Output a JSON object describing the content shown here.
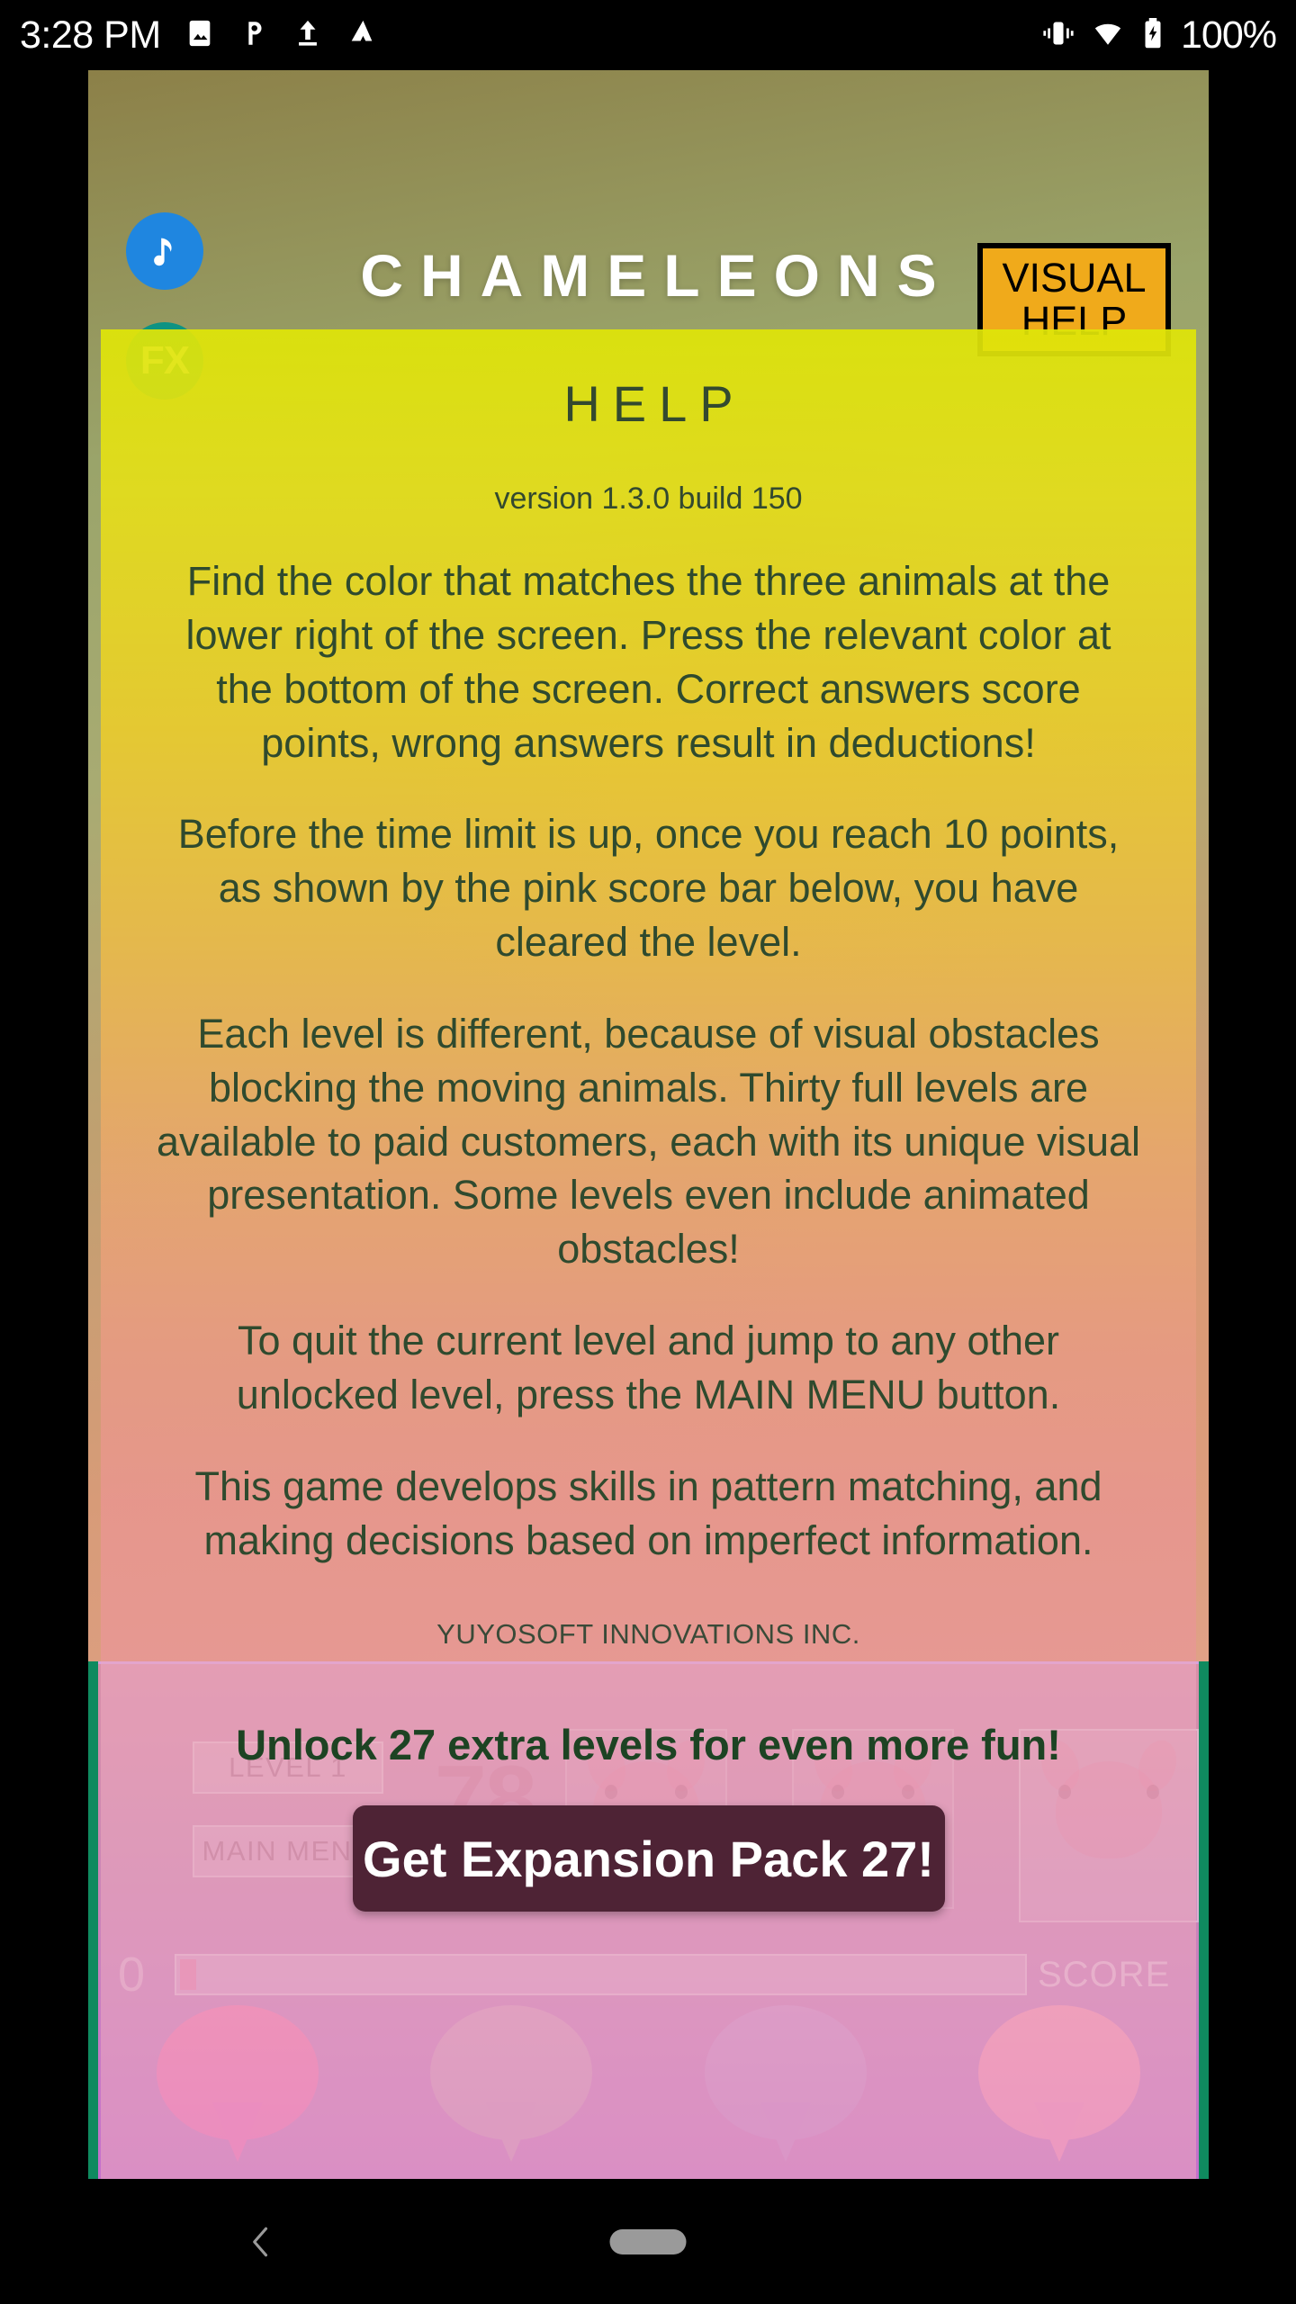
{
  "status_bar": {
    "time": "3:28 PM",
    "battery": "100%",
    "icons": [
      "image-icon",
      "photos-icon",
      "upload-icon",
      "drive-icon",
      "vibrate-icon",
      "wifi-icon",
      "battery-charging-icon"
    ]
  },
  "header": {
    "app_title": "CHAMELEONS",
    "visual_help_line1": "VISUAL",
    "visual_help_line2": "HELP",
    "music_icon": "music-note-icon",
    "fx_label": "FX"
  },
  "help_panel": {
    "title": "HELP",
    "version": "version 1.3.0 build 150",
    "paragraphs": [
      "Find the color that matches the three animals at the lower right of the screen. Press the relevant color at the bottom of the screen. Correct answers score points, wrong answers result in deductions!",
      "Before the time limit is up, once you reach 10 points, as shown by the pink score bar below, you have cleared the level.",
      "Each level is different, because of visual obstacles blocking the moving animals. Thirty full levels are available to paid customers, each with its unique visual presentation. Some levels even include animated obstacles!",
      "To quit the current level and jump to any other unlocked level, press the MAIN MENU button.",
      "This game develops skills in pattern matching, and making decisions based on imperfect information."
    ],
    "company": "YUYOSOFT INNOVATIONS INC."
  },
  "promo": {
    "headline": "Unlock 27 extra levels for even more fun!",
    "button_label": "Get Expansion Pack 27!"
  },
  "game_background": {
    "level_button": "LEVEL 1",
    "main_menu_button": "MAIN MENU",
    "timer": "78",
    "score_value": "0",
    "score_label": "SCORE",
    "color_buttons": [
      {
        "name": "pink",
        "hex": "#ec6fb4"
      },
      {
        "name": "faded-1",
        "hex": "#cf8dc0"
      },
      {
        "name": "faded-2",
        "hex": "#c57fcb"
      },
      {
        "name": "salmon-pink",
        "hex": "#ef8fb6"
      }
    ]
  },
  "nav_bar": {
    "back_icon": "chevron-left-icon",
    "home_icon": "home-pill-icon"
  }
}
